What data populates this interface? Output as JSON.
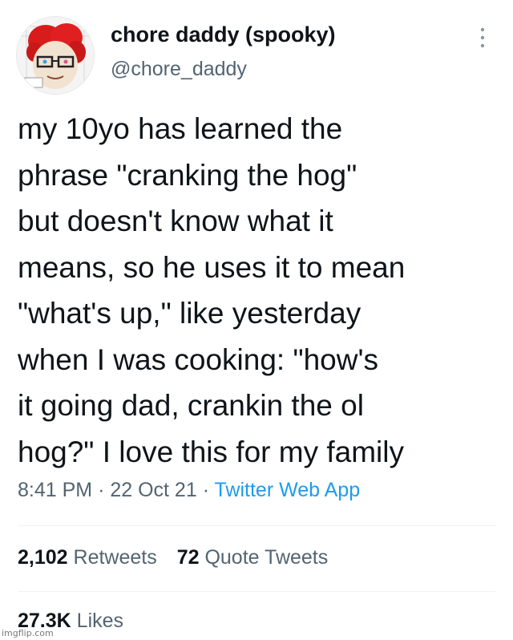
{
  "user": {
    "display_name": "chore daddy (spooky)",
    "handle": "@chore_daddy",
    "avatar": "avatar-image"
  },
  "tweet": {
    "text": "my 10yo has learned the\nphrase \"cranking the hog\"\nbut doesn't know what it\nmeans, so he uses it to mean\n\"what's up,\" like yesterday\nwhen I was cooking: \"how's\nit going dad, crankin the ol\nhog?\" I love this for my family",
    "time": "8:41 PM",
    "separator": "·",
    "date": "22 Oct 21",
    "source": "Twitter Web App"
  },
  "stats": {
    "retweets_count": "2,102",
    "retweets_label": "Retweets",
    "quotes_count": "72",
    "quotes_label": "Quote Tweets",
    "likes_count": "27.3K",
    "likes_label": "Likes"
  },
  "icons": {
    "more": "more-vertical-icon"
  },
  "watermark": "imgflip.com",
  "colors": {
    "text": "#0f1419",
    "secondary": "#536471",
    "link": "#1d9bf0",
    "divider": "#eff3f4"
  }
}
